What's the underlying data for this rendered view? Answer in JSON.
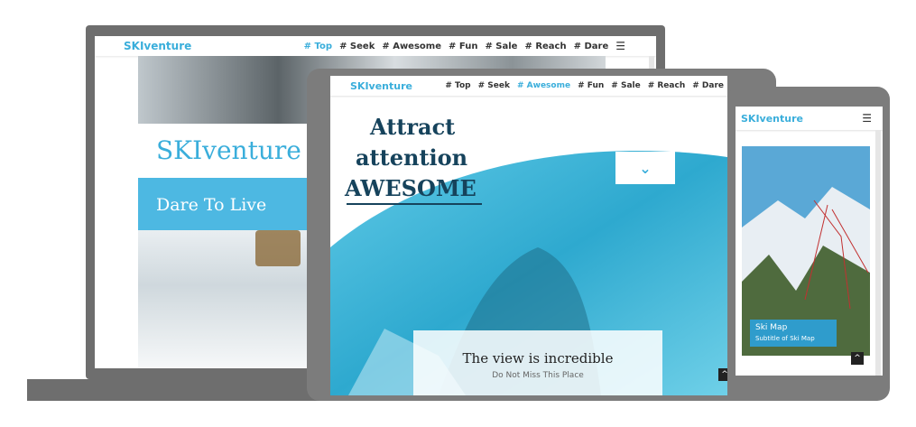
{
  "laptop": {
    "brand": "SKIventure",
    "nav": [
      "# Top",
      "# Seek",
      "# Awesome",
      "# Fun",
      "# Sale",
      "# Reach",
      "# Dare"
    ],
    "active_index": 0,
    "hero_title": "SKIventure",
    "banner_text": "Dare To Live"
  },
  "tablet": {
    "brand": "SKIventure",
    "nav": [
      "# Top",
      "# Seek",
      "# Awesome",
      "# Fun",
      "# Sale",
      "# Reach",
      "# Dare"
    ],
    "active_index": 2,
    "headline_1": "Attract",
    "headline_2": "attention",
    "headline_3": "AWESOME",
    "card_title": "The view is incredible",
    "card_subtitle": "Do Not Miss This Place"
  },
  "phone": {
    "brand": "SKIventure",
    "map_title": "Ski Map",
    "map_subtitle": "Subtitle of Ski Map"
  },
  "colors": {
    "accent": "#3aaedb",
    "device_gray": "#777777",
    "headline_navy": "#16435c"
  },
  "icons": {
    "menu": "hamburger-icon",
    "down": "chevron-down-icon",
    "up": "chevron-up-icon"
  }
}
